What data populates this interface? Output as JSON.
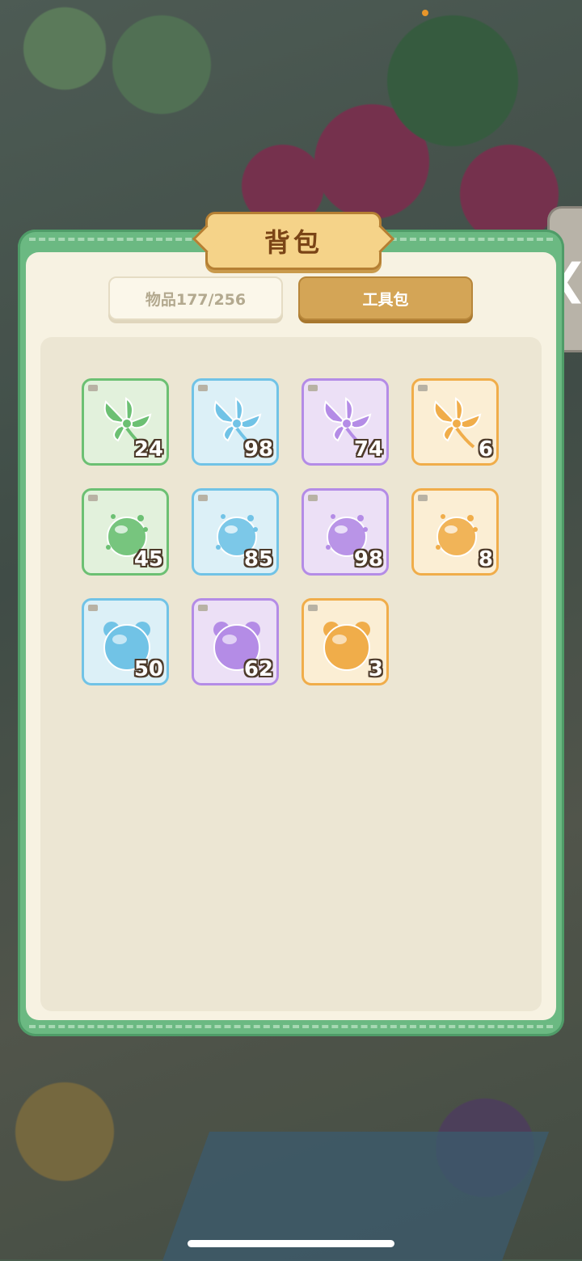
{
  "panel": {
    "title": "背包",
    "tabs": [
      {
        "label": "物品177/256",
        "active": false
      },
      {
        "label": "工具包",
        "active": true
      }
    ]
  },
  "side_tab": {
    "glyph": "❮"
  },
  "items": [
    {
      "name": "green-pinwheel",
      "count": "24",
      "rarity": "green"
    },
    {
      "name": "blue-pinwheel",
      "count": "98",
      "rarity": "blue"
    },
    {
      "name": "purple-pinwheel",
      "count": "74",
      "rarity": "purple"
    },
    {
      "name": "gold-pinwheel",
      "count": "6",
      "rarity": "gold"
    },
    {
      "name": "green-orb",
      "count": "45",
      "rarity": "green"
    },
    {
      "name": "blue-orb",
      "count": "85",
      "rarity": "blue"
    },
    {
      "name": "purple-orb",
      "count": "98",
      "rarity": "purple"
    },
    {
      "name": "gold-orb",
      "count": "8",
      "rarity": "gold"
    },
    {
      "name": "blue-bear-bubble",
      "count": "50",
      "rarity": "blue"
    },
    {
      "name": "purple-bear-bubble",
      "count": "62",
      "rarity": "purple"
    },
    {
      "name": "orange-bear-bubble",
      "count": "3",
      "rarity": "gold"
    }
  ],
  "colors": {
    "green": "#6cc073",
    "blue": "#71c3e6",
    "purple": "#b48ce6",
    "gold": "#f0ad4a"
  }
}
